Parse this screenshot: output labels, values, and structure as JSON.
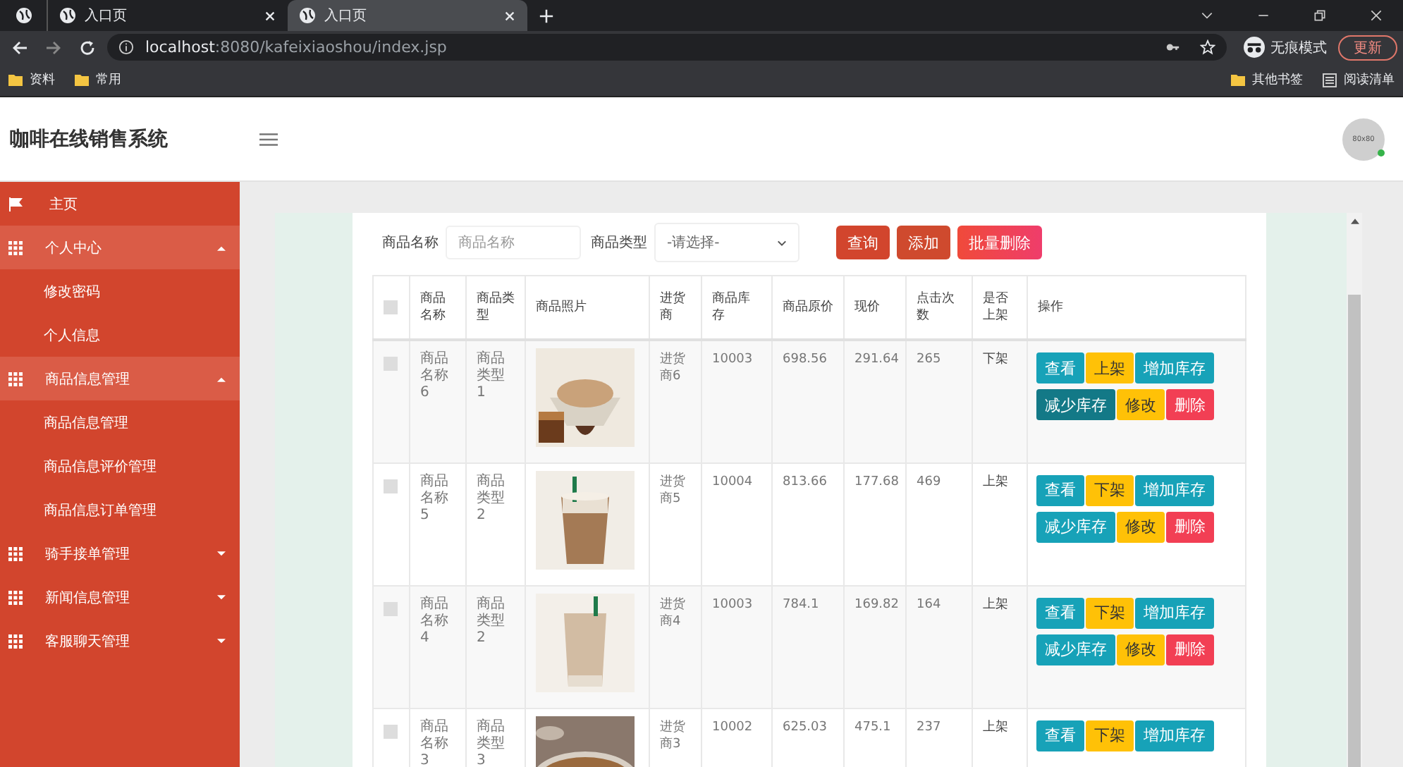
{
  "browser": {
    "tabs": [
      {
        "kind": "pinned",
        "selected": false
      },
      {
        "kind": "page",
        "title": "入口页",
        "selected": false
      },
      {
        "kind": "page",
        "title": "入口页",
        "selected": true
      }
    ],
    "address": {
      "host": "localhost",
      "path": ":8080/kafeixiaoshou/index.jsp"
    },
    "profile_label": "无痕模式",
    "update_button": "更新",
    "bookmarks": [
      "资料",
      "常用"
    ],
    "bookmarks_right": [
      {
        "kind": "folder",
        "label": "其他书签"
      },
      {
        "kind": "list",
        "label": "阅读清单"
      }
    ]
  },
  "header": {
    "title": "咖啡在线销售系统",
    "avatar_text": "80x80",
    "online": true
  },
  "sidebar": {
    "items": [
      {
        "kind": "link",
        "label": "主页"
      },
      {
        "kind": "group",
        "label": "个人中心",
        "expanded": true,
        "children": [
          {
            "label": "修改密码"
          },
          {
            "label": "个人信息"
          }
        ]
      },
      {
        "kind": "group",
        "label": "商品信息管理",
        "expanded": true,
        "children": [
          {
            "label": "商品信息管理"
          },
          {
            "label": "商品信息评价管理"
          },
          {
            "label": "商品信息订单管理"
          }
        ]
      },
      {
        "kind": "group",
        "label": "骑手接单管理",
        "expanded": false
      },
      {
        "kind": "group",
        "label": "新闻信息管理",
        "expanded": false
      },
      {
        "kind": "group",
        "label": "客服聊天管理",
        "expanded": false
      }
    ]
  },
  "filter": {
    "fields": [
      {
        "kind": "input",
        "label": "商品名称",
        "placeholder": "商品名称"
      },
      {
        "kind": "select",
        "label": "商品类型",
        "value": "-请选择-"
      }
    ],
    "buttons": [
      {
        "kind": "primary",
        "label": "查询"
      },
      {
        "kind": "secondary",
        "label": "添加"
      },
      {
        "kind": "danger",
        "label": "批量删除"
      }
    ]
  },
  "table": {
    "select_all_checked": false,
    "columns": [
      "商品名称",
      "商品类型",
      "商品照片",
      "进货商",
      "商品库存",
      "商品原价",
      "现价",
      "点击次数",
      "是否上架",
      "操作"
    ],
    "rows": [
      {
        "checked": false,
        "name": "商品名称6",
        "type": "商品类型1",
        "supplier": "进货商6",
        "stock": "10003",
        "original_price": "698.56",
        "price": "291.64",
        "clicks": "265",
        "on_shelf": "下架",
        "actions": [
          {
            "kind": "info",
            "label": "查看"
          },
          {
            "kind": "warning",
            "label": "上架"
          },
          {
            "kind": "info",
            "label": "增加库存"
          },
          {
            "kind": "info",
            "label": "减少库存",
            "hovered": true
          },
          {
            "kind": "warning",
            "label": "修改"
          },
          {
            "kind": "danger",
            "label": "删除"
          }
        ]
      },
      {
        "checked": false,
        "name": "商品名称5",
        "type": "商品类型2",
        "supplier": "进货商5",
        "stock": "10004",
        "original_price": "813.66",
        "price": "177.68",
        "clicks": "469",
        "on_shelf": "上架",
        "actions": [
          {
            "kind": "info",
            "label": "查看"
          },
          {
            "kind": "warning",
            "label": "下架"
          },
          {
            "kind": "info",
            "label": "增加库存"
          },
          {
            "kind": "info",
            "label": "减少库存",
            "hovered": false
          },
          {
            "kind": "warning",
            "label": "修改"
          },
          {
            "kind": "danger",
            "label": "删除"
          }
        ]
      },
      {
        "checked": false,
        "name": "商品名称4",
        "type": "商品类型2",
        "supplier": "进货商4",
        "stock": "10003",
        "original_price": "784.1",
        "price": "169.82",
        "clicks": "164",
        "on_shelf": "上架",
        "actions": [
          {
            "kind": "info",
            "label": "查看"
          },
          {
            "kind": "warning",
            "label": "下架"
          },
          {
            "kind": "info",
            "label": "增加库存"
          },
          {
            "kind": "info",
            "label": "减少库存",
            "hovered": false
          },
          {
            "kind": "warning",
            "label": "修改"
          },
          {
            "kind": "danger",
            "label": "删除"
          }
        ]
      },
      {
        "checked": false,
        "name": "商品名称3",
        "type": "商品类型3",
        "supplier": "进货商3",
        "stock": "10002",
        "original_price": "625.03",
        "price": "475.1",
        "clicks": "237",
        "on_shelf": "上架",
        "actions": [
          {
            "kind": "info",
            "label": "查看"
          },
          {
            "kind": "warning",
            "label": "下架"
          },
          {
            "kind": "info",
            "label": "增加库存"
          }
        ]
      }
    ]
  }
}
